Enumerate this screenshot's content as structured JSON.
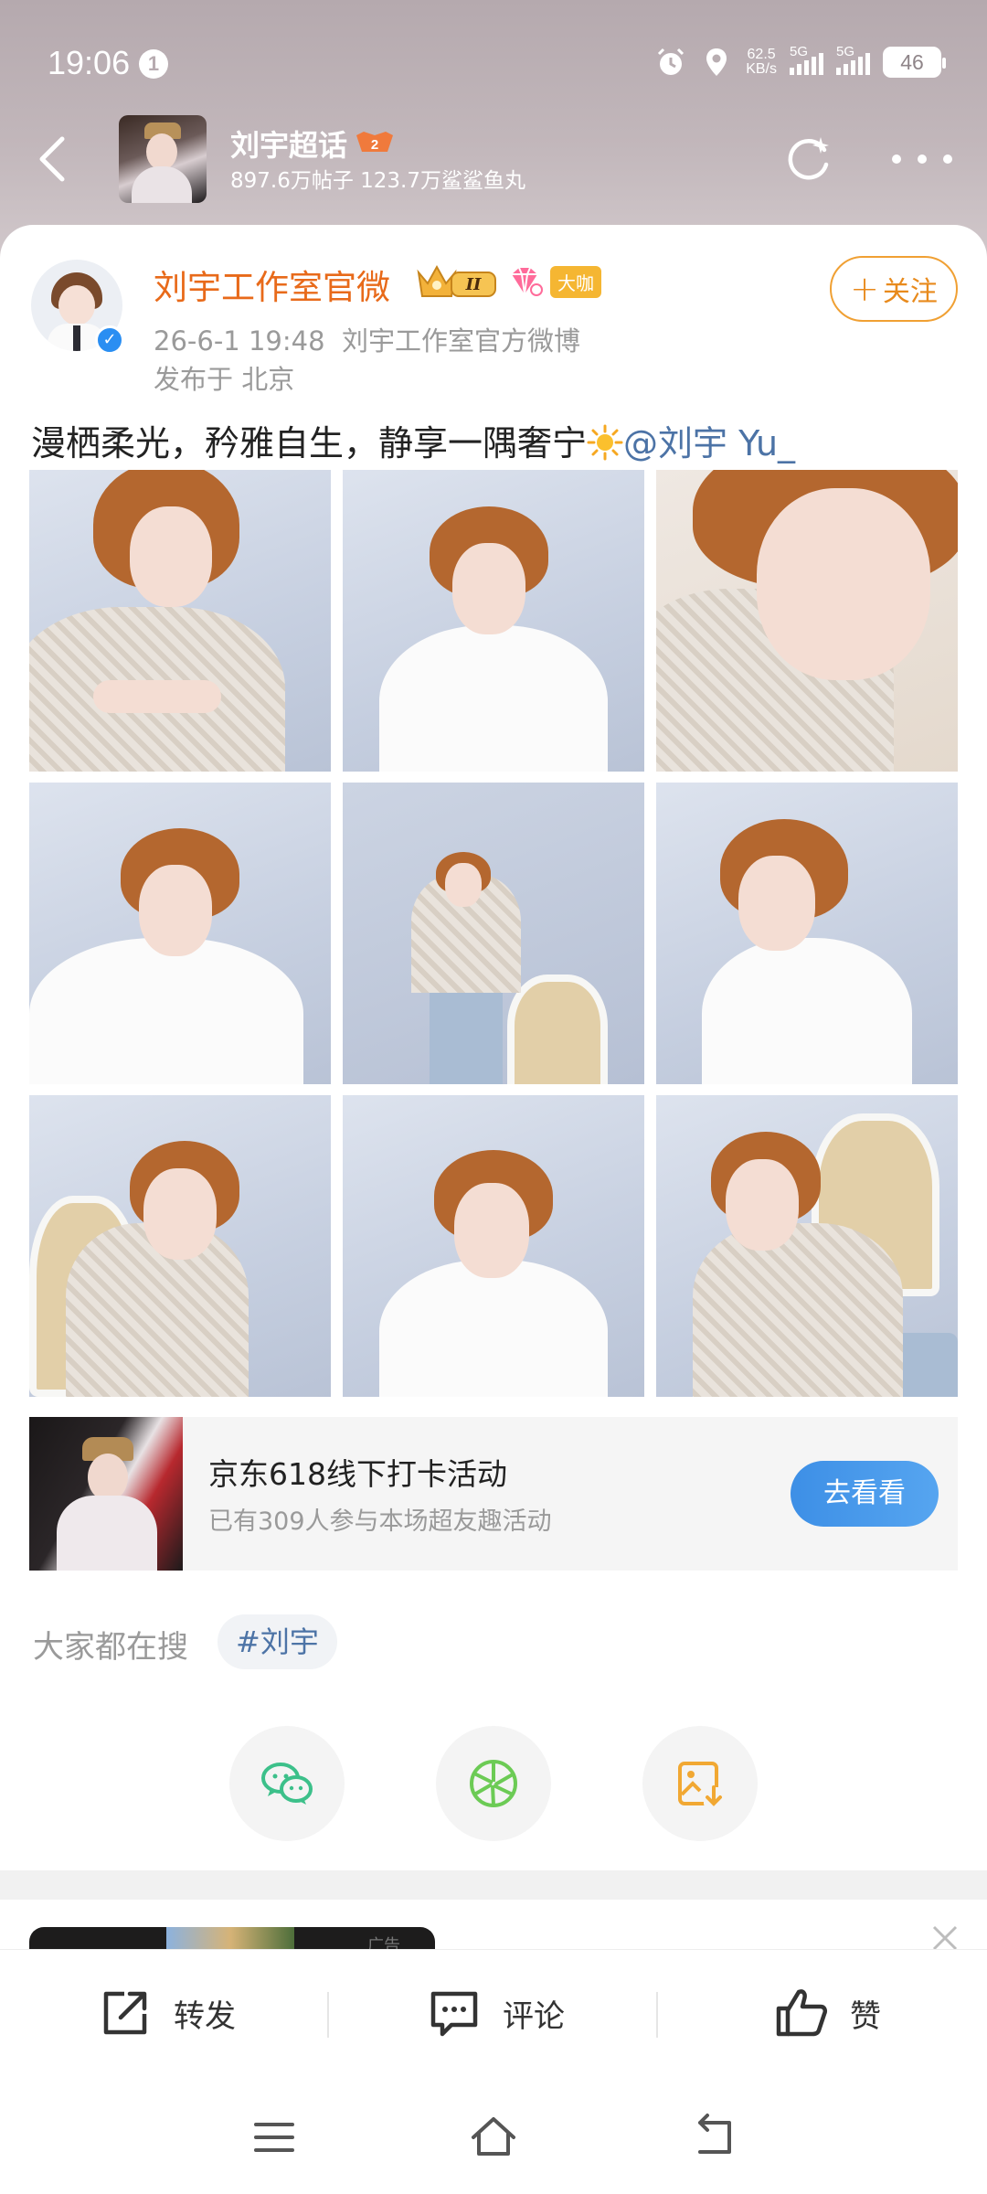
{
  "status_bar": {
    "time": "19:06",
    "notification_count": "1",
    "net_speed_value": "62.5",
    "net_speed_unit": "KB/s",
    "sim1_label": "5G",
    "sim2_label": "5G",
    "battery": "46"
  },
  "header": {
    "group_name": "刘宇超话",
    "group_stats": "897.6万帖子 123.7万鲨鲨鱼丸",
    "level_badge": "2"
  },
  "post": {
    "author_name": "刘宇工作室官微",
    "crown_badge_level": "II",
    "tag_badge": "大咖",
    "follow_label": "关注",
    "follow_plus": "+",
    "timestamp": "26-6-1 19:48",
    "source": "刘宇工作室官方微博",
    "location": "发布于 北京",
    "text": "漫栖柔光，矜雅自生，静享一隅奢宁",
    "mention": "@刘宇 Yu_",
    "photo_count": 9
  },
  "activity": {
    "title": "京东618线下打卡活动",
    "subtitle": "已有309人参与本场超友趣活动",
    "button": "去看看"
  },
  "search": {
    "label": "大家都在搜",
    "tag": "#刘宇"
  },
  "share": {
    "icons": [
      "wechat-icon",
      "moments-icon",
      "save-image-icon"
    ]
  },
  "next_card": {
    "ad_label": "广告"
  },
  "actions": {
    "repost": "转发",
    "comment": "评论",
    "like": "赞"
  },
  "colors": {
    "accent_orange": "#e86a1a",
    "mention_blue": "#4c73a6",
    "button_blue": "#3d8fe6"
  }
}
